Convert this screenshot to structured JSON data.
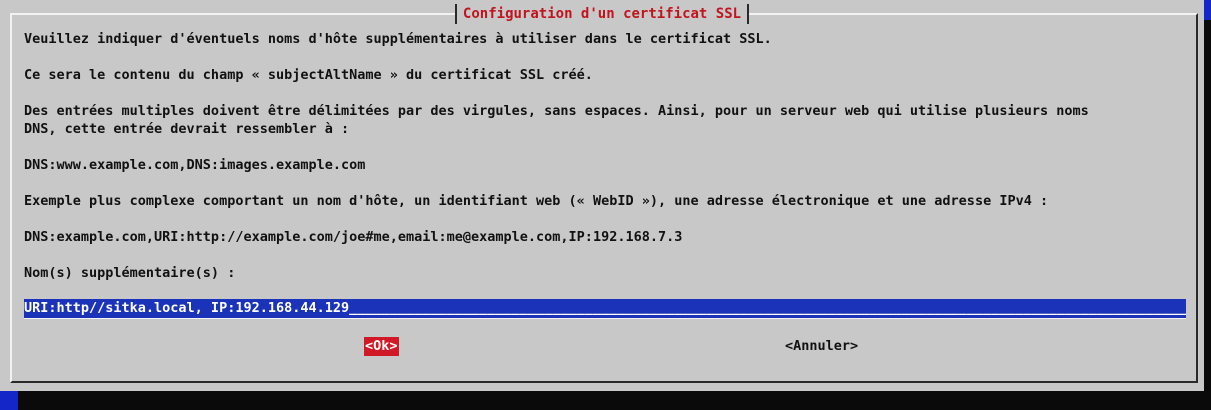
{
  "dialog": {
    "title": "Configuration d'un certificat SSL",
    "lines": [
      "Veuillez indiquer d'éventuels noms d'hôte supplémentaires à utiliser dans le certificat SSL.",
      "Ce sera le contenu du champ « subjectAltName » du certificat SSL créé.",
      "Des entrées multiples doivent être délimitées par des virgules, sans espaces. Ainsi, pour un serveur web qui utilise plusieurs noms",
      "DNS, cette entrée devrait ressembler à :",
      "DNS:www.example.com,DNS:images.example.com",
      "Exemple plus complexe comportant un nom d'hôte, un identifiant web (« WebID »), une adresse électronique et une adresse IPv4 :",
      "DNS:example.com,URI:http://example.com/joe#me,email:me@example.com,IP:192.168.7.3",
      "Nom(s) supplémentaire(s) :"
    ],
    "input_value": "URI:http//sitka.local, IP:192.168.44.129",
    "input_fill": "_____________________________________________________________________________________________________________________________",
    "ok_label": "<Ok>",
    "cancel_label": "<Annuler>"
  },
  "colors": {
    "background": "#1426c8",
    "dialog": "#c8c8c8",
    "title": "#c0141e",
    "input_bg": "#1a33b8",
    "ok_bg": "#d01826"
  }
}
